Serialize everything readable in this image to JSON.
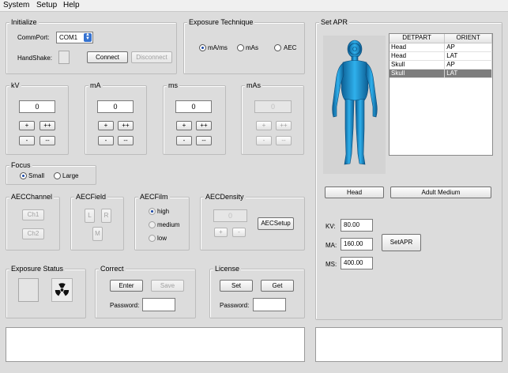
{
  "menu": [
    "System",
    "Setup",
    "Help"
  ],
  "initialize": {
    "title": "Initialize",
    "commport_label": "CommPort:",
    "commport_value": "COM1",
    "handshake_label": "HandShake:",
    "connect": "Connect",
    "disconnect": "Disconnect"
  },
  "exposure_technique": {
    "title": "Exposure Technique",
    "options": [
      "mA/ms",
      "mAs",
      "AEC"
    ],
    "selected": "mA/ms"
  },
  "kv": {
    "title": "kV",
    "value": "0",
    "plus": "+",
    "plusplus": "++",
    "minus": "-",
    "minusminus": "--"
  },
  "ma": {
    "title": "mA",
    "value": "0",
    "plus": "+",
    "plusplus": "++",
    "minus": "-",
    "minusminus": "--"
  },
  "ms": {
    "title": "ms",
    "value": "0",
    "plus": "+",
    "plusplus": "++",
    "minus": "-",
    "minusminus": "--"
  },
  "mas": {
    "title": "mAs",
    "value": "0",
    "plus": "+",
    "plusplus": "++",
    "minus": "-",
    "minusminus": "--"
  },
  "focus": {
    "title": "Focus",
    "options": [
      "Small",
      "Large"
    ],
    "selected": "Small"
  },
  "aec_channel": {
    "title": "AECChannel",
    "ch1": "Ch1",
    "ch2": "Ch2"
  },
  "aec_field": {
    "title": "AECField",
    "l": "L",
    "r": "R",
    "m": "M"
  },
  "aec_film": {
    "title": "AECFilm",
    "options": [
      "high",
      "medium",
      "low"
    ],
    "selected": "high"
  },
  "aec_density": {
    "title": "AECDensity",
    "value": "0",
    "plus": "+",
    "minus": "-",
    "setup": "AECSetup"
  },
  "exposure_status": {
    "title": "Exposure Status"
  },
  "correct": {
    "title": "Correct",
    "enter": "Enter",
    "save": "Save",
    "password_label": "Password:"
  },
  "license": {
    "title": "License",
    "set": "Set",
    "get": "Get",
    "password_label": "Password:"
  },
  "set_apr": {
    "title": "Set APR",
    "table": {
      "columns": [
        "DETPART",
        "ORIENT"
      ],
      "rows": [
        [
          "Head",
          "AP"
        ],
        [
          "Head",
          "LAT"
        ],
        [
          "Skull",
          "AP"
        ],
        [
          "Skull",
          "LAT"
        ]
      ],
      "selected_row": 3
    },
    "body_part_button": "Head",
    "patient_size_button": "Adult Medium",
    "kv_label": "KV:",
    "kv_value": "80.00",
    "ma_label": "MA:",
    "ma_value": "160.00",
    "ms_label": "MS:",
    "ms_value": "400.00",
    "set_apr_button": "SetAPR"
  },
  "colors": {
    "window_bg": "#dcdcdc",
    "body_model": "#1b8fd0",
    "selected_row": "#7d7d7d",
    "radiation_icon": "#111111"
  }
}
